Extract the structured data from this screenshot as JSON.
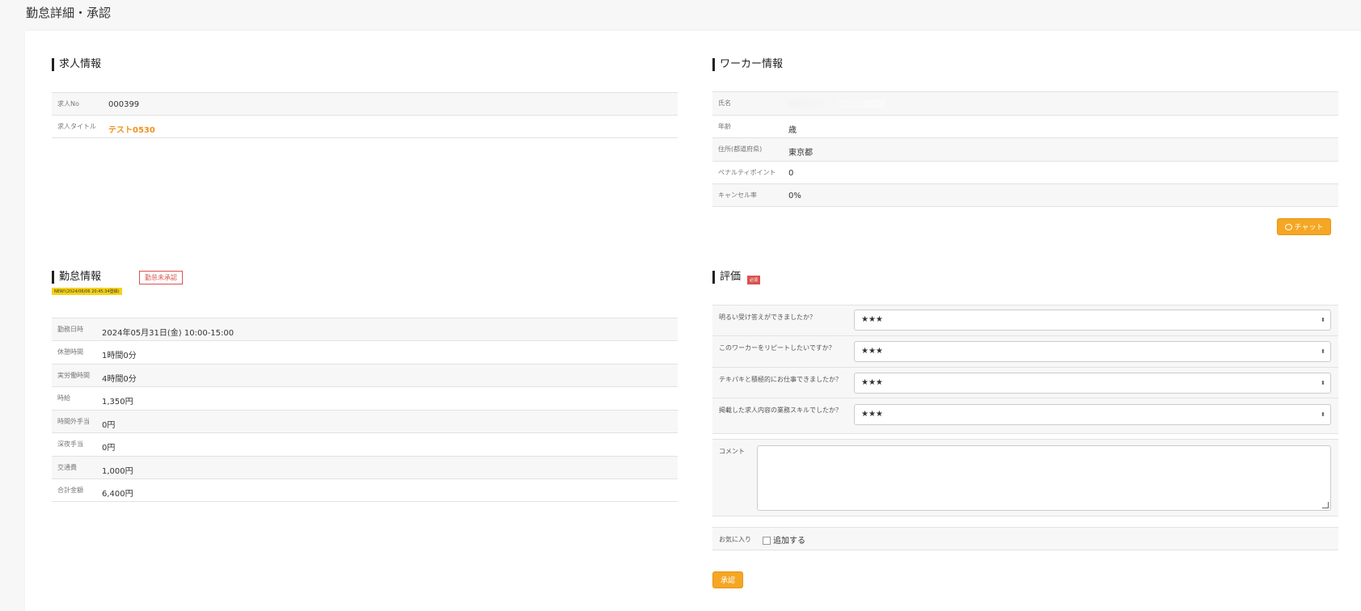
{
  "page_title": "勤怠詳細・承認",
  "job_info": {
    "title": "求人情報",
    "rows": [
      {
        "label": "求人No",
        "value": "000399"
      },
      {
        "label": "求人タイトル",
        "value": "テスト0530"
      }
    ]
  },
  "worker_info": {
    "title": "ワーカー情報",
    "rows": [
      {
        "label": "氏名",
        "value": ""
      },
      {
        "label": "年齢",
        "value": "歳"
      },
      {
        "label": "住所(都道府県)",
        "value": "東京都"
      },
      {
        "label": "ペナルティポイント",
        "value": "0"
      },
      {
        "label": "キャンセル率",
        "value": "0%"
      }
    ],
    "chat_label": "チャット"
  },
  "attendance": {
    "title": "勤怠情報",
    "status_badge": "勤怠未承認",
    "new_tag": "NEW!(2024/06/06 20:45:34登録)",
    "rows": [
      {
        "label": "勤務日時",
        "value": "2024年05月31日(金) 10:00-15:00"
      },
      {
        "label": "休憩時間",
        "value": "1時間0分"
      },
      {
        "label": "実労働時間",
        "value": "4時間0分"
      },
      {
        "label": "時給",
        "value": "1,350円"
      },
      {
        "label": "時間外手当",
        "value": "0円"
      },
      {
        "label": "深夜手当",
        "value": "0円"
      },
      {
        "label": "交通費",
        "value": "1,000円"
      },
      {
        "label": "合計金額",
        "value": "6,400円"
      }
    ]
  },
  "evaluation": {
    "title": "評価",
    "required_badge": "必須",
    "questions": [
      {
        "label": "明るい受け答えができましたか？",
        "selected": "★★★"
      },
      {
        "label": "このワーカーをリピートしたいですか？",
        "selected": "★★★"
      },
      {
        "label": "テキパキと積極的にお仕事できましたか？",
        "selected": "★★★"
      },
      {
        "label": "掲載した求人内容の業務スキルでしたか？",
        "selected": "★★★"
      }
    ],
    "comment_label": "コメント",
    "comment_value": "",
    "favorite_label": "お気に入り",
    "favorite_checkbox_label": "追加する",
    "approve_label": "承認"
  }
}
